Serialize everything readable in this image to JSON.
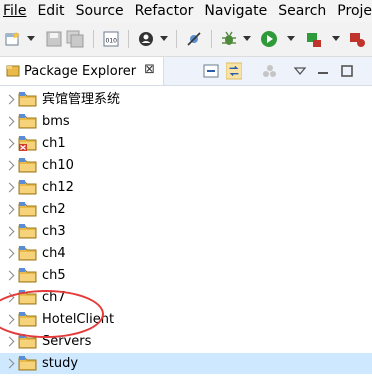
{
  "menubar": {
    "items": [
      {
        "label": "File"
      },
      {
        "label": "Edit"
      },
      {
        "label": "Source"
      },
      {
        "label": "Refactor"
      },
      {
        "label": "Navigate"
      },
      {
        "label": "Search"
      },
      {
        "label": "Proje"
      }
    ]
  },
  "toolbar": {
    "icons": [
      "new-icon",
      "save-icon",
      "save-all-icon",
      "binary-icon",
      "team-icon",
      "no-breakpoint-icon",
      "debug-icon",
      "run-icon",
      "external-tools-icon",
      "coverage-icon"
    ]
  },
  "package_explorer": {
    "title": "Package Explorer",
    "close_glyph": "⊠",
    "projects": [
      {
        "label": "宾馆管理系统",
        "error": false,
        "selected": false
      },
      {
        "label": "bms",
        "error": false,
        "selected": false
      },
      {
        "label": "ch1",
        "error": true,
        "selected": false
      },
      {
        "label": "ch10",
        "error": false,
        "selected": false
      },
      {
        "label": "ch12",
        "error": false,
        "selected": false
      },
      {
        "label": "ch2",
        "error": false,
        "selected": false
      },
      {
        "label": "ch3",
        "error": false,
        "selected": false
      },
      {
        "label": "ch4",
        "error": false,
        "selected": false
      },
      {
        "label": "ch5",
        "error": false,
        "selected": false
      },
      {
        "label": "ch7",
        "error": false,
        "selected": false
      },
      {
        "label": "HotelClient",
        "error": false,
        "selected": false
      },
      {
        "label": "Servers",
        "error": false,
        "selected": false
      },
      {
        "label": "study",
        "error": false,
        "selected": true
      }
    ]
  },
  "colors": {
    "selection": "#cde8ff",
    "highlight_circle": "#e43a3a",
    "folder": "#e9b949"
  }
}
